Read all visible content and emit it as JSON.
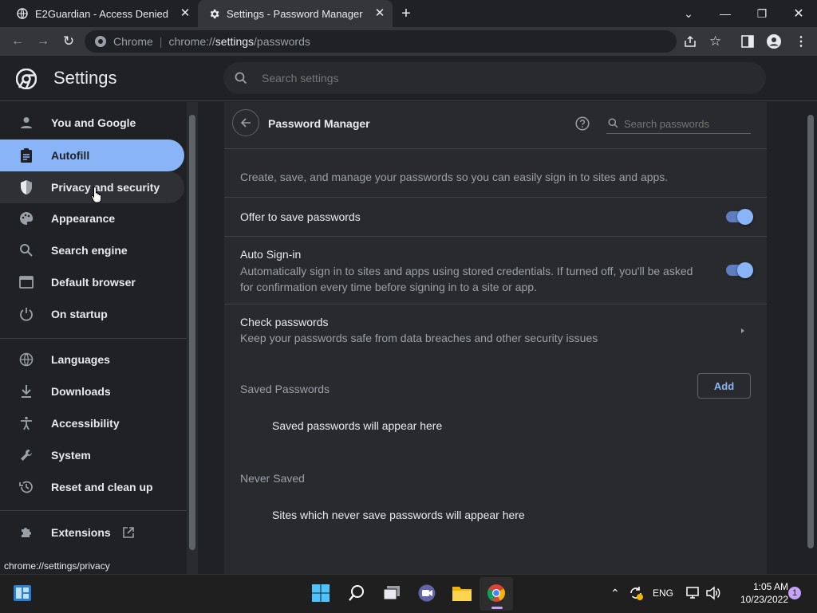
{
  "tabs": [
    {
      "title": "E2Guardian - Access Denied",
      "icon": "globe-icon",
      "active": false
    },
    {
      "title": "Settings - Password Manager",
      "icon": "gear-icon",
      "active": true
    }
  ],
  "window_controls": [
    "chevron-down-icon",
    "minimize-icon",
    "restore-icon",
    "close-icon"
  ],
  "omnibox": {
    "site_label": "Chrome",
    "url_prefix": "chrome://",
    "url_host": "settings",
    "url_path": "/passwords"
  },
  "header": {
    "title": "Settings",
    "search_placeholder": "Search settings"
  },
  "sidebar": {
    "items": [
      {
        "label": "You and Google",
        "icon": "person-icon"
      },
      {
        "label": "Autofill",
        "icon": "clipboard-icon",
        "active": true
      },
      {
        "label": "Privacy and security",
        "icon": "shield-icon",
        "hover": true
      },
      {
        "label": "Appearance",
        "icon": "palette-icon"
      },
      {
        "label": "Search engine",
        "icon": "search-icon"
      },
      {
        "label": "Default browser",
        "icon": "browser-icon"
      },
      {
        "label": "On startup",
        "icon": "power-icon"
      },
      {
        "label": "Languages",
        "icon": "globe-icon"
      },
      {
        "label": "Downloads",
        "icon": "download-icon"
      },
      {
        "label": "Accessibility",
        "icon": "accessibility-icon"
      },
      {
        "label": "System",
        "icon": "wrench-icon"
      },
      {
        "label": "Reset and clean up",
        "icon": "history-icon"
      },
      {
        "label": "Extensions",
        "icon": "puzzle-icon"
      }
    ]
  },
  "status_bar": {
    "url": "chrome://settings/privacy"
  },
  "password_manager": {
    "title": "Password Manager",
    "search_placeholder": "Search passwords",
    "description": "Create, save, and manage your passwords so you can easily sign in to sites and apps.",
    "offer_to_save": {
      "label": "Offer to save passwords",
      "enabled": true
    },
    "auto_signin": {
      "label": "Auto Sign-in",
      "sublabel": "Automatically sign in to sites and apps using stored credentials. If turned off, you'll be asked for confirmation every time before signing in to a site or app.",
      "enabled": true
    },
    "check_passwords": {
      "label": "Check passwords",
      "sublabel": "Keep your passwords safe from data breaches and other security issues"
    },
    "saved_passwords": {
      "heading": "Saved Passwords",
      "add_label": "Add",
      "empty_text": "Saved passwords will appear here"
    },
    "never_saved": {
      "heading": "Never Saved",
      "empty_text": "Sites which never save passwords will appear here"
    }
  },
  "taskbar": {
    "language": "ENG",
    "time": "1:05 AM",
    "date": "10/23/2022",
    "notification_count": "1"
  },
  "colors": {
    "accent": "#8ab4f8",
    "background": "#202124",
    "card": "#292a2d"
  }
}
